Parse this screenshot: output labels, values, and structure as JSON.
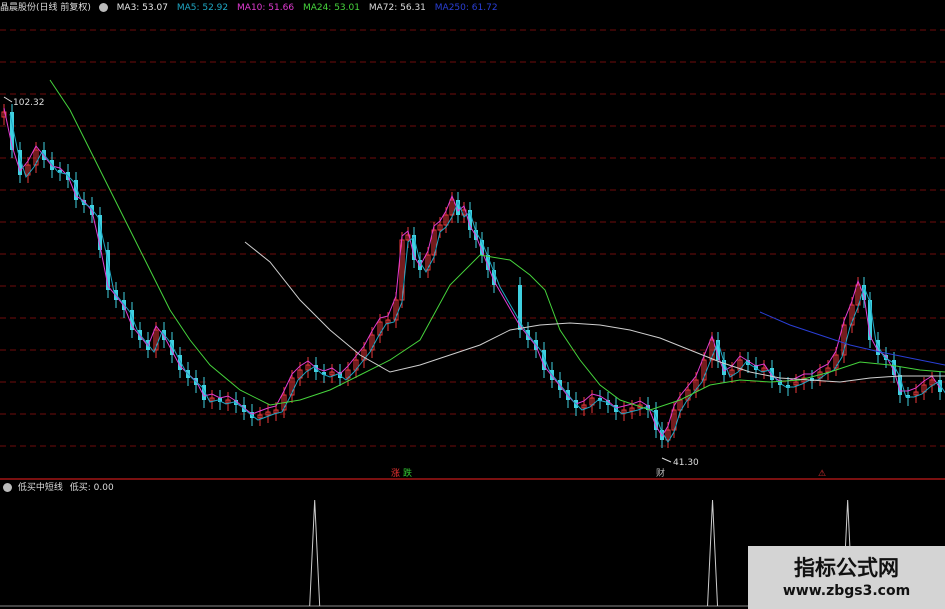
{
  "header": {
    "stock": "晶晨股份(日线 前复权)",
    "indicators": [
      {
        "label": "MA3: 53.07",
        "color": "#e8e8e8"
      },
      {
        "label": "MA5: 52.92",
        "color": "#1fa7c4"
      },
      {
        "label": "MA10: 51.66",
        "color": "#e23bd2"
      },
      {
        "label": "MA24: 53.01",
        "color": "#46d43c"
      },
      {
        "label": "MA72: 56.31",
        "color": "#dcdcdc"
      },
      {
        "label": "MA250: 61.72",
        "color": "#2a3fd6"
      }
    ]
  },
  "main_chart": {
    "high_label": "102.32",
    "low_label": "41.30",
    "marks": [
      {
        "text": "涨",
        "color": "#e33"
      },
      {
        "text": "跌",
        "color": "#3c3"
      },
      {
        "text": "财",
        "color": "#bbb"
      },
      {
        "text": "⚠",
        "color": "#d33"
      }
    ]
  },
  "sub_chart": {
    "title": "低买中短线",
    "value_label": "低买: 0.00",
    "spikes": [
      {
        "position": 0.333
      },
      {
        "position": 0.754
      },
      {
        "position": 0.897
      }
    ]
  },
  "watermark": {
    "title": "指标公式网",
    "url": "www.zbgs3.com"
  },
  "colors": {
    "up": "#e8383a",
    "down": "#3fd0e0",
    "grid": "#7a1010",
    "background": "#000000"
  }
}
